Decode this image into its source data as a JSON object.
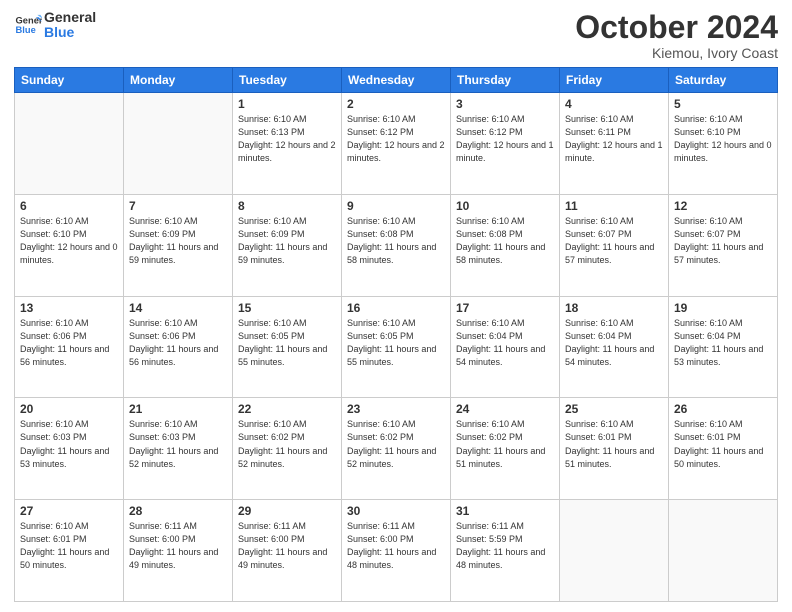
{
  "logo": {
    "line1": "General",
    "line2": "Blue"
  },
  "title": "October 2024",
  "subtitle": "Kiemou, Ivory Coast",
  "weekdays": [
    "Sunday",
    "Monday",
    "Tuesday",
    "Wednesday",
    "Thursday",
    "Friday",
    "Saturday"
  ],
  "weeks": [
    [
      {
        "num": "",
        "info": ""
      },
      {
        "num": "",
        "info": ""
      },
      {
        "num": "1",
        "info": "Sunrise: 6:10 AM\nSunset: 6:13 PM\nDaylight: 12 hours and 2 minutes."
      },
      {
        "num": "2",
        "info": "Sunrise: 6:10 AM\nSunset: 6:12 PM\nDaylight: 12 hours and 2 minutes."
      },
      {
        "num": "3",
        "info": "Sunrise: 6:10 AM\nSunset: 6:12 PM\nDaylight: 12 hours and 1 minute."
      },
      {
        "num": "4",
        "info": "Sunrise: 6:10 AM\nSunset: 6:11 PM\nDaylight: 12 hours and 1 minute."
      },
      {
        "num": "5",
        "info": "Sunrise: 6:10 AM\nSunset: 6:10 PM\nDaylight: 12 hours and 0 minutes."
      }
    ],
    [
      {
        "num": "6",
        "info": "Sunrise: 6:10 AM\nSunset: 6:10 PM\nDaylight: 12 hours and 0 minutes."
      },
      {
        "num": "7",
        "info": "Sunrise: 6:10 AM\nSunset: 6:09 PM\nDaylight: 11 hours and 59 minutes."
      },
      {
        "num": "8",
        "info": "Sunrise: 6:10 AM\nSunset: 6:09 PM\nDaylight: 11 hours and 59 minutes."
      },
      {
        "num": "9",
        "info": "Sunrise: 6:10 AM\nSunset: 6:08 PM\nDaylight: 11 hours and 58 minutes."
      },
      {
        "num": "10",
        "info": "Sunrise: 6:10 AM\nSunset: 6:08 PM\nDaylight: 11 hours and 58 minutes."
      },
      {
        "num": "11",
        "info": "Sunrise: 6:10 AM\nSunset: 6:07 PM\nDaylight: 11 hours and 57 minutes."
      },
      {
        "num": "12",
        "info": "Sunrise: 6:10 AM\nSunset: 6:07 PM\nDaylight: 11 hours and 57 minutes."
      }
    ],
    [
      {
        "num": "13",
        "info": "Sunrise: 6:10 AM\nSunset: 6:06 PM\nDaylight: 11 hours and 56 minutes."
      },
      {
        "num": "14",
        "info": "Sunrise: 6:10 AM\nSunset: 6:06 PM\nDaylight: 11 hours and 56 minutes."
      },
      {
        "num": "15",
        "info": "Sunrise: 6:10 AM\nSunset: 6:05 PM\nDaylight: 11 hours and 55 minutes."
      },
      {
        "num": "16",
        "info": "Sunrise: 6:10 AM\nSunset: 6:05 PM\nDaylight: 11 hours and 55 minutes."
      },
      {
        "num": "17",
        "info": "Sunrise: 6:10 AM\nSunset: 6:04 PM\nDaylight: 11 hours and 54 minutes."
      },
      {
        "num": "18",
        "info": "Sunrise: 6:10 AM\nSunset: 6:04 PM\nDaylight: 11 hours and 54 minutes."
      },
      {
        "num": "19",
        "info": "Sunrise: 6:10 AM\nSunset: 6:04 PM\nDaylight: 11 hours and 53 minutes."
      }
    ],
    [
      {
        "num": "20",
        "info": "Sunrise: 6:10 AM\nSunset: 6:03 PM\nDaylight: 11 hours and 53 minutes."
      },
      {
        "num": "21",
        "info": "Sunrise: 6:10 AM\nSunset: 6:03 PM\nDaylight: 11 hours and 52 minutes."
      },
      {
        "num": "22",
        "info": "Sunrise: 6:10 AM\nSunset: 6:02 PM\nDaylight: 11 hours and 52 minutes."
      },
      {
        "num": "23",
        "info": "Sunrise: 6:10 AM\nSunset: 6:02 PM\nDaylight: 11 hours and 52 minutes."
      },
      {
        "num": "24",
        "info": "Sunrise: 6:10 AM\nSunset: 6:02 PM\nDaylight: 11 hours and 51 minutes."
      },
      {
        "num": "25",
        "info": "Sunrise: 6:10 AM\nSunset: 6:01 PM\nDaylight: 11 hours and 51 minutes."
      },
      {
        "num": "26",
        "info": "Sunrise: 6:10 AM\nSunset: 6:01 PM\nDaylight: 11 hours and 50 minutes."
      }
    ],
    [
      {
        "num": "27",
        "info": "Sunrise: 6:10 AM\nSunset: 6:01 PM\nDaylight: 11 hours and 50 minutes."
      },
      {
        "num": "28",
        "info": "Sunrise: 6:11 AM\nSunset: 6:00 PM\nDaylight: 11 hours and 49 minutes."
      },
      {
        "num": "29",
        "info": "Sunrise: 6:11 AM\nSunset: 6:00 PM\nDaylight: 11 hours and 49 minutes."
      },
      {
        "num": "30",
        "info": "Sunrise: 6:11 AM\nSunset: 6:00 PM\nDaylight: 11 hours and 48 minutes."
      },
      {
        "num": "31",
        "info": "Sunrise: 6:11 AM\nSunset: 5:59 PM\nDaylight: 11 hours and 48 minutes."
      },
      {
        "num": "",
        "info": ""
      },
      {
        "num": "",
        "info": ""
      }
    ]
  ]
}
